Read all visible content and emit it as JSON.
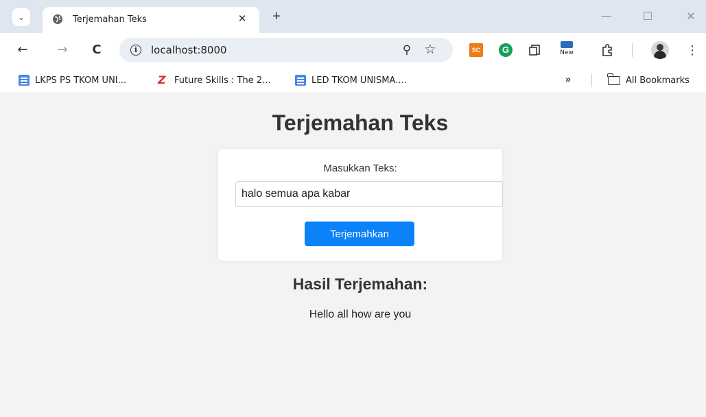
{
  "browser": {
    "tab": {
      "title": "Terjemahan Teks",
      "close_glyph": "✕",
      "favicon": "globe-icon"
    },
    "new_tab_glyph": "+",
    "tab_search_glyph": "⌄",
    "window_controls": {
      "minimize": "—",
      "maximize": "☐",
      "close": "✕"
    },
    "nav": {
      "back": "←",
      "forward": "→",
      "reload": "C"
    },
    "omnibox": {
      "url": "localhost:8000",
      "info_glyph": "i",
      "zoom_glyph": "⚲",
      "star_glyph": "☆"
    },
    "extensions": {
      "sc_label": "SC",
      "g_label": "G",
      "new_label": "New"
    },
    "menu_glyph": "⋮",
    "bookmarks": {
      "items": [
        {
          "label": "LKPS PS TKOM UNI...",
          "icon": "doc-icon"
        },
        {
          "label": "Future Skills : The 2...",
          "icon": "z-icon"
        },
        {
          "label": "LED TKOM UNISMA....",
          "icon": "doc-icon"
        }
      ],
      "overflow_glyph": "»",
      "all_bookmarks": "All Bookmarks"
    }
  },
  "app": {
    "title": "Terjemahan Teks",
    "form": {
      "label": "Masukkan Teks:",
      "input_value": "halo semua apa kabar",
      "button": "Terjemahkan"
    },
    "result": {
      "title": "Hasil Terjemahan:",
      "text": "Hello all how are you"
    }
  },
  "colors": {
    "primary_button": "#0b82f7",
    "page_bg": "#f3f3f3",
    "tabstrip_bg": "#dfe6f0"
  }
}
